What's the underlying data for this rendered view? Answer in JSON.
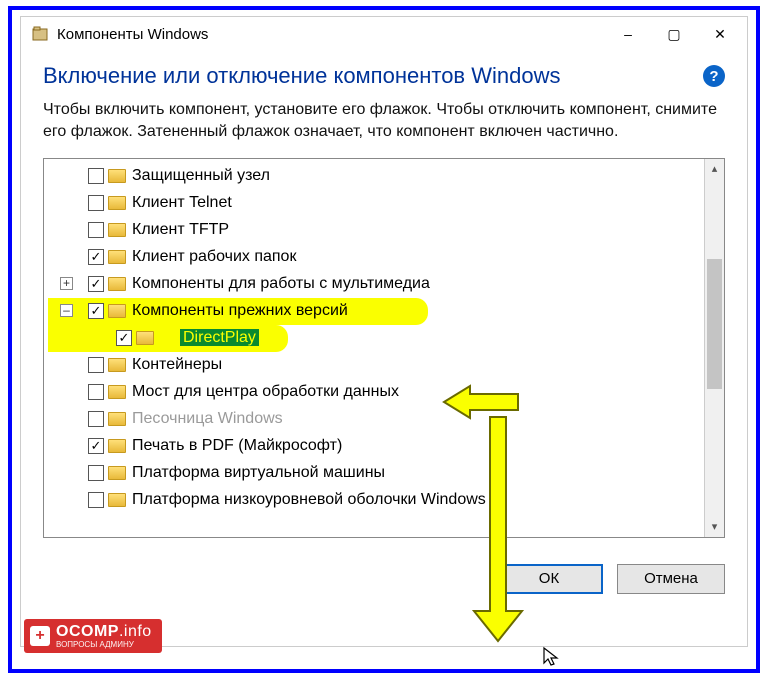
{
  "window": {
    "title": "Компоненты Windows",
    "minimize": "–",
    "maximize": "▢",
    "close": "✕"
  },
  "heading": "Включение или отключение компонентов Windows",
  "help": "?",
  "description": "Чтобы включить компонент, установите его флажок. Чтобы отключить компонент, снимите его флажок. Затененный флажок означает, что компонент включен частично.",
  "tree": [
    {
      "label": "Защищенный узел",
      "checked": false,
      "level": 0
    },
    {
      "label": "Клиент Telnet",
      "checked": false,
      "level": 0
    },
    {
      "label": "Клиент TFTP",
      "checked": false,
      "level": 0
    },
    {
      "label": "Клиент рабочих папок",
      "checked": true,
      "level": 0
    },
    {
      "label": "Компоненты для работы с мультимедиа",
      "checked": true,
      "level": 0,
      "expander": "+"
    },
    {
      "label": "Компоненты прежних версий",
      "checked": true,
      "level": 0,
      "expander": "–",
      "hl": true
    },
    {
      "label": "DirectPlay",
      "checked": true,
      "level": 2,
      "dp": true
    },
    {
      "label": "Контейнеры",
      "checked": false,
      "level": 0
    },
    {
      "label": "Мост для центра обработки данных",
      "checked": false,
      "level": 0
    },
    {
      "label": "Песочница Windows",
      "checked": false,
      "level": 0,
      "disabled": true
    },
    {
      "label": "Печать в PDF (Майкрософт)",
      "checked": true,
      "level": 0
    },
    {
      "label": "Платформа виртуальной машины",
      "checked": false,
      "level": 0
    },
    {
      "label": "Платформа низкоуровневой оболочки Windows",
      "checked": false,
      "level": 0
    }
  ],
  "buttons": {
    "ok": "ОК",
    "cancel": "Отмена"
  },
  "watermark": {
    "text": "OCOMP",
    "suffix": ".info",
    "sub": "ВОПРОСЫ АДМИНУ"
  }
}
